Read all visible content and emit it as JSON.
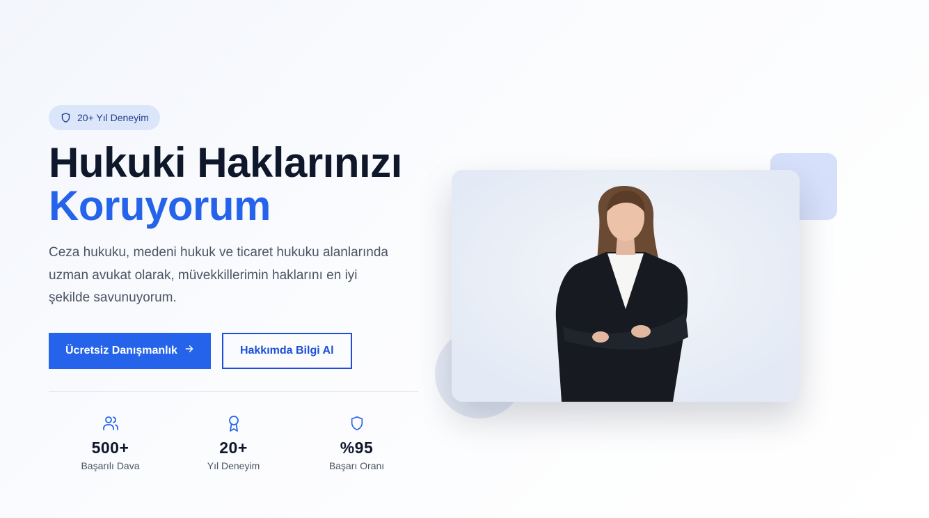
{
  "hero": {
    "badge": {
      "icon": "shield-icon",
      "label": "20+ Yıl Deneyim"
    },
    "title_line1": "Hukuki Haklarınızı",
    "title_line2": "Koruyorum",
    "description": "Ceza hukuku, medeni hukuk ve ticaret hukuku alanlarında uzman avukat olarak, müvekkillerimin haklarını en iyi şekilde savunuyorum.",
    "primary_button": {
      "label": "Ücretsiz Danışmanlık",
      "icon": "arrow-right-icon"
    },
    "secondary_button": {
      "label": "Hakkımda Bilgi Al"
    }
  },
  "stats": [
    {
      "icon": "users-icon",
      "value": "500+",
      "label": "Başarılı Dava"
    },
    {
      "icon": "award-icon",
      "value": "20+",
      "label": "Yıl Deneyim"
    },
    {
      "icon": "shield-icon",
      "value": "%95",
      "label": "Başarı Oranı"
    }
  ],
  "colors": {
    "accent": "#2563eb",
    "heading": "#0f172a",
    "body_text": "#4b5563",
    "badge_bg": "#dbe6fb"
  }
}
